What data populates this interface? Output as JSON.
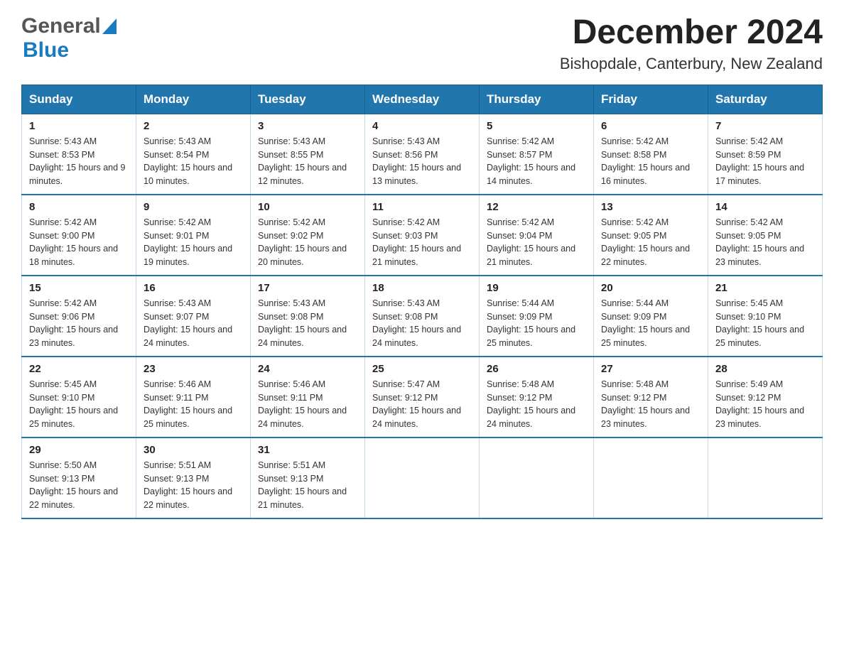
{
  "header": {
    "logo_general": "General",
    "logo_blue": "Blue",
    "calendar_title": "December 2024",
    "calendar_subtitle": "Bishopdale, Canterbury, New Zealand"
  },
  "days_of_week": [
    "Sunday",
    "Monday",
    "Tuesday",
    "Wednesday",
    "Thursday",
    "Friday",
    "Saturday"
  ],
  "weeks": [
    [
      {
        "day": "1",
        "sunrise": "Sunrise: 5:43 AM",
        "sunset": "Sunset: 8:53 PM",
        "daylight": "Daylight: 15 hours and 9 minutes."
      },
      {
        "day": "2",
        "sunrise": "Sunrise: 5:43 AM",
        "sunset": "Sunset: 8:54 PM",
        "daylight": "Daylight: 15 hours and 10 minutes."
      },
      {
        "day": "3",
        "sunrise": "Sunrise: 5:43 AM",
        "sunset": "Sunset: 8:55 PM",
        "daylight": "Daylight: 15 hours and 12 minutes."
      },
      {
        "day": "4",
        "sunrise": "Sunrise: 5:43 AM",
        "sunset": "Sunset: 8:56 PM",
        "daylight": "Daylight: 15 hours and 13 minutes."
      },
      {
        "day": "5",
        "sunrise": "Sunrise: 5:42 AM",
        "sunset": "Sunset: 8:57 PM",
        "daylight": "Daylight: 15 hours and 14 minutes."
      },
      {
        "day": "6",
        "sunrise": "Sunrise: 5:42 AM",
        "sunset": "Sunset: 8:58 PM",
        "daylight": "Daylight: 15 hours and 16 minutes."
      },
      {
        "day": "7",
        "sunrise": "Sunrise: 5:42 AM",
        "sunset": "Sunset: 8:59 PM",
        "daylight": "Daylight: 15 hours and 17 minutes."
      }
    ],
    [
      {
        "day": "8",
        "sunrise": "Sunrise: 5:42 AM",
        "sunset": "Sunset: 9:00 PM",
        "daylight": "Daylight: 15 hours and 18 minutes."
      },
      {
        "day": "9",
        "sunrise": "Sunrise: 5:42 AM",
        "sunset": "Sunset: 9:01 PM",
        "daylight": "Daylight: 15 hours and 19 minutes."
      },
      {
        "day": "10",
        "sunrise": "Sunrise: 5:42 AM",
        "sunset": "Sunset: 9:02 PM",
        "daylight": "Daylight: 15 hours and 20 minutes."
      },
      {
        "day": "11",
        "sunrise": "Sunrise: 5:42 AM",
        "sunset": "Sunset: 9:03 PM",
        "daylight": "Daylight: 15 hours and 21 minutes."
      },
      {
        "day": "12",
        "sunrise": "Sunrise: 5:42 AM",
        "sunset": "Sunset: 9:04 PM",
        "daylight": "Daylight: 15 hours and 21 minutes."
      },
      {
        "day": "13",
        "sunrise": "Sunrise: 5:42 AM",
        "sunset": "Sunset: 9:05 PM",
        "daylight": "Daylight: 15 hours and 22 minutes."
      },
      {
        "day": "14",
        "sunrise": "Sunrise: 5:42 AM",
        "sunset": "Sunset: 9:05 PM",
        "daylight": "Daylight: 15 hours and 23 minutes."
      }
    ],
    [
      {
        "day": "15",
        "sunrise": "Sunrise: 5:42 AM",
        "sunset": "Sunset: 9:06 PM",
        "daylight": "Daylight: 15 hours and 23 minutes."
      },
      {
        "day": "16",
        "sunrise": "Sunrise: 5:43 AM",
        "sunset": "Sunset: 9:07 PM",
        "daylight": "Daylight: 15 hours and 24 minutes."
      },
      {
        "day": "17",
        "sunrise": "Sunrise: 5:43 AM",
        "sunset": "Sunset: 9:08 PM",
        "daylight": "Daylight: 15 hours and 24 minutes."
      },
      {
        "day": "18",
        "sunrise": "Sunrise: 5:43 AM",
        "sunset": "Sunset: 9:08 PM",
        "daylight": "Daylight: 15 hours and 24 minutes."
      },
      {
        "day": "19",
        "sunrise": "Sunrise: 5:44 AM",
        "sunset": "Sunset: 9:09 PM",
        "daylight": "Daylight: 15 hours and 25 minutes."
      },
      {
        "day": "20",
        "sunrise": "Sunrise: 5:44 AM",
        "sunset": "Sunset: 9:09 PM",
        "daylight": "Daylight: 15 hours and 25 minutes."
      },
      {
        "day": "21",
        "sunrise": "Sunrise: 5:45 AM",
        "sunset": "Sunset: 9:10 PM",
        "daylight": "Daylight: 15 hours and 25 minutes."
      }
    ],
    [
      {
        "day": "22",
        "sunrise": "Sunrise: 5:45 AM",
        "sunset": "Sunset: 9:10 PM",
        "daylight": "Daylight: 15 hours and 25 minutes."
      },
      {
        "day": "23",
        "sunrise": "Sunrise: 5:46 AM",
        "sunset": "Sunset: 9:11 PM",
        "daylight": "Daylight: 15 hours and 25 minutes."
      },
      {
        "day": "24",
        "sunrise": "Sunrise: 5:46 AM",
        "sunset": "Sunset: 9:11 PM",
        "daylight": "Daylight: 15 hours and 24 minutes."
      },
      {
        "day": "25",
        "sunrise": "Sunrise: 5:47 AM",
        "sunset": "Sunset: 9:12 PM",
        "daylight": "Daylight: 15 hours and 24 minutes."
      },
      {
        "day": "26",
        "sunrise": "Sunrise: 5:48 AM",
        "sunset": "Sunset: 9:12 PM",
        "daylight": "Daylight: 15 hours and 24 minutes."
      },
      {
        "day": "27",
        "sunrise": "Sunrise: 5:48 AM",
        "sunset": "Sunset: 9:12 PM",
        "daylight": "Daylight: 15 hours and 23 minutes."
      },
      {
        "day": "28",
        "sunrise": "Sunrise: 5:49 AM",
        "sunset": "Sunset: 9:12 PM",
        "daylight": "Daylight: 15 hours and 23 minutes."
      }
    ],
    [
      {
        "day": "29",
        "sunrise": "Sunrise: 5:50 AM",
        "sunset": "Sunset: 9:13 PM",
        "daylight": "Daylight: 15 hours and 22 minutes."
      },
      {
        "day": "30",
        "sunrise": "Sunrise: 5:51 AM",
        "sunset": "Sunset: 9:13 PM",
        "daylight": "Daylight: 15 hours and 22 minutes."
      },
      {
        "day": "31",
        "sunrise": "Sunrise: 5:51 AM",
        "sunset": "Sunset: 9:13 PM",
        "daylight": "Daylight: 15 hours and 21 minutes."
      },
      null,
      null,
      null,
      null
    ]
  ]
}
